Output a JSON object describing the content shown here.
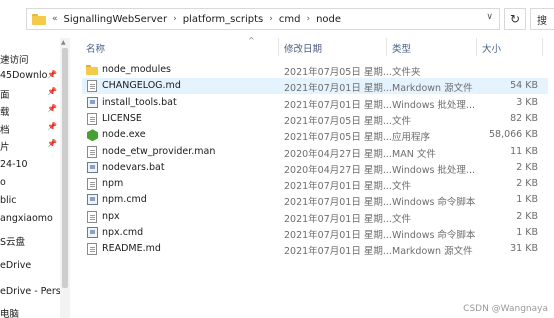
{
  "address_bar": {
    "overflow": "«",
    "crumbs": [
      "SignallingWebServer",
      "platform_scripts",
      "cmd",
      "node"
    ],
    "separator": "›",
    "dropdown": "∨",
    "refresh": "↻",
    "search_glyph": "搜"
  },
  "sidebar": {
    "items": [
      {
        "label": "速访问",
        "pinned": false
      },
      {
        "label": "45Downlo",
        "pinned": true
      },
      {
        "label": "面",
        "pinned": true
      },
      {
        "label": "载",
        "pinned": true
      },
      {
        "label": "档",
        "pinned": true
      },
      {
        "label": "片",
        "pinned": true
      },
      {
        "label": "24-10",
        "pinned": false
      },
      {
        "label": "o",
        "pinned": false
      },
      {
        "label": "blic",
        "pinned": false
      },
      {
        "label": "angxiaomo",
        "pinned": false
      },
      {
        "label": "S云盘",
        "pinned": false
      },
      {
        "label": "eDrive",
        "pinned": false
      },
      {
        "label": "eDrive - Persc",
        "pinned": false
      },
      {
        "label": "电脑",
        "pinned": false
      }
    ],
    "pin_glyph": "📌"
  },
  "columns": {
    "name": "名称",
    "date": "修改日期",
    "type": "类型",
    "size": "大小",
    "sort_arrow": "^"
  },
  "files": [
    {
      "name": "node_modules",
      "date": "2021年07月05日 星期...",
      "type": "文件夹",
      "size": "",
      "icon": "folder-icon",
      "selected": false
    },
    {
      "name": "CHANGELOG.md",
      "date": "2021年07月01日 星期...",
      "type": "Markdown 源文件",
      "size": "54 KB",
      "icon": "markdown-file-icon",
      "selected": true
    },
    {
      "name": "install_tools.bat",
      "date": "2021年07月01日 星期...",
      "type": "Windows 批处理...",
      "size": "3 KB",
      "icon": "batch-file-icon",
      "selected": false
    },
    {
      "name": "LICENSE",
      "date": "2021年07月05日 星期...",
      "type": "文件",
      "size": "82 KB",
      "icon": "file-icon",
      "selected": false
    },
    {
      "name": "node.exe",
      "date": "2021年07月05日 星期...",
      "type": "应用程序",
      "size": "58,066 KB",
      "icon": "node-exe-icon",
      "selected": false
    },
    {
      "name": "node_etw_provider.man",
      "date": "2020年04月27日 星期...",
      "type": "MAN 文件",
      "size": "11 KB",
      "icon": "file-icon",
      "selected": false
    },
    {
      "name": "nodevars.bat",
      "date": "2020年04月27日 星期...",
      "type": "Windows 批处理...",
      "size": "2 KB",
      "icon": "batch-file-icon",
      "selected": false
    },
    {
      "name": "npm",
      "date": "2021年07月01日 星期...",
      "type": "文件",
      "size": "2 KB",
      "icon": "file-icon",
      "selected": false
    },
    {
      "name": "npm.cmd",
      "date": "2021年07月01日 星期...",
      "type": "Windows 命令脚本",
      "size": "1 KB",
      "icon": "cmd-file-icon",
      "selected": false
    },
    {
      "name": "npx",
      "date": "2021年07月01日 星期...",
      "type": "文件",
      "size": "2 KB",
      "icon": "file-icon",
      "selected": false
    },
    {
      "name": "npx.cmd",
      "date": "2021年07月01日 星期...",
      "type": "Windows 命令脚本",
      "size": "1 KB",
      "icon": "cmd-file-icon",
      "selected": false
    },
    {
      "name": "README.md",
      "date": "2021年07月01日 星期...",
      "type": "Markdown 源文件",
      "size": "31 KB",
      "icon": "markdown-file-icon",
      "selected": false
    }
  ],
  "watermark": "CSDN @Wangnaya"
}
